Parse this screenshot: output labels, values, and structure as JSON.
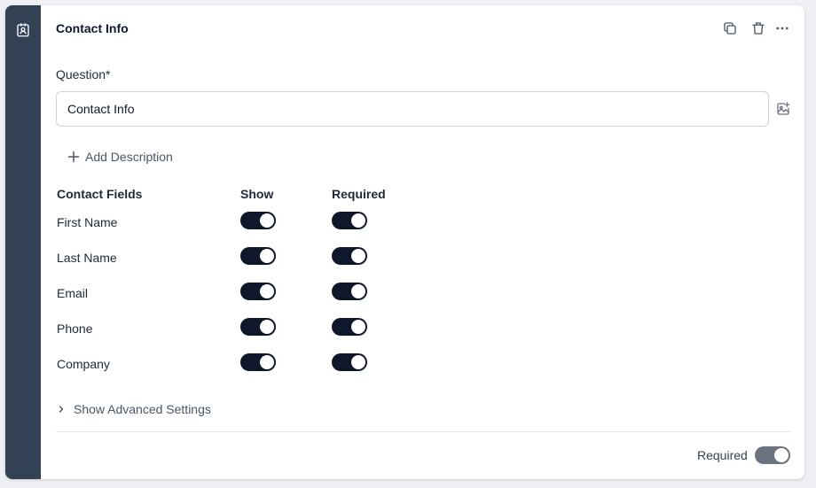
{
  "card": {
    "title": "Contact Info",
    "icons": {
      "rail": "contact-card-icon",
      "duplicate": "copy-icon",
      "delete": "trash-icon",
      "more": "more-horizontal-icon",
      "image": "image-add-icon"
    }
  },
  "question": {
    "label": "Question*",
    "value": "Contact Info",
    "add_description": "Add Description"
  },
  "fields": {
    "headers": {
      "field": "Contact Fields",
      "show": "Show",
      "required": "Required"
    },
    "rows": [
      {
        "label": "First Name",
        "show": true,
        "required": true
      },
      {
        "label": "Last Name",
        "show": true,
        "required": true
      },
      {
        "label": "Email",
        "show": true,
        "required": true
      },
      {
        "label": "Phone",
        "show": true,
        "required": true
      },
      {
        "label": "Company",
        "show": true,
        "required": true
      }
    ]
  },
  "advanced": {
    "label": "Show Advanced Settings"
  },
  "footer": {
    "required_label": "Required",
    "required_on": true
  },
  "colors": {
    "rail": "#334155",
    "toggle_on": "#0f172a",
    "toggle_muted": "#6b7280"
  }
}
